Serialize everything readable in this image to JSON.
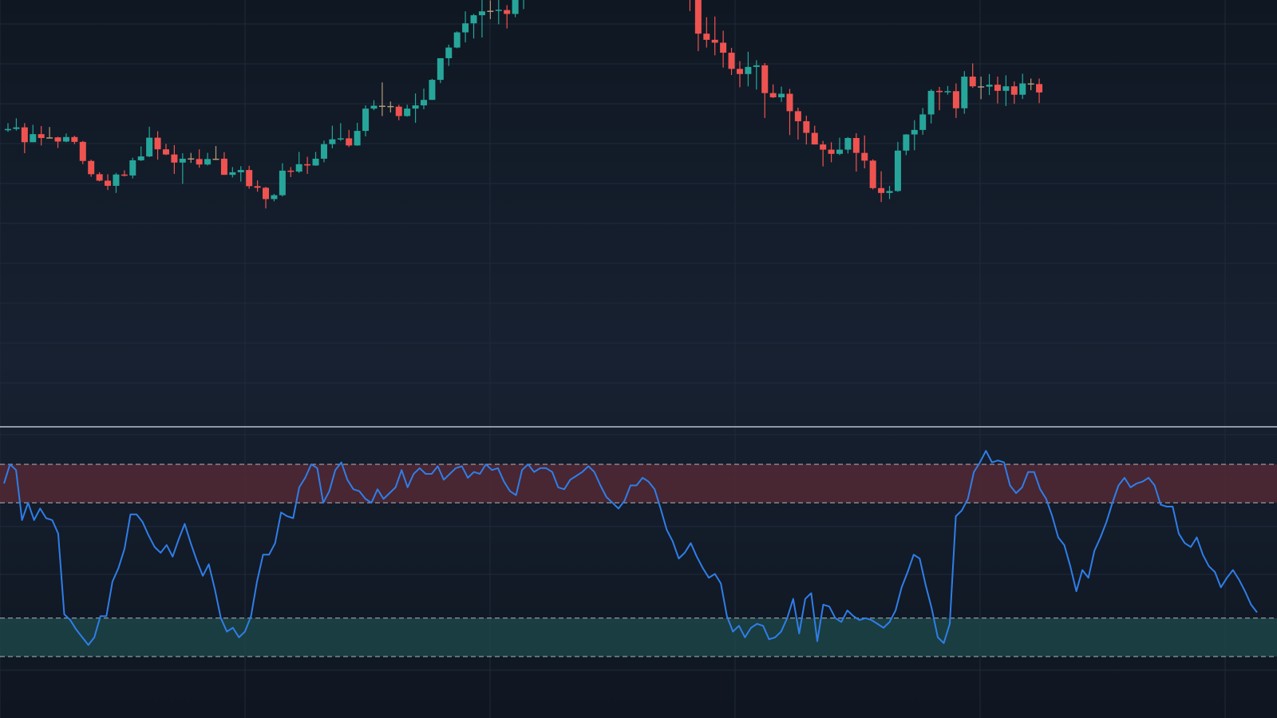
{
  "theme": {
    "bg_top": "#0f1722",
    "bg_mid": "#172131",
    "bg_bottom": "#0f1621",
    "grid": "#1f2a39",
    "separator": "#b9c2cc",
    "up": "#26a69a",
    "down": "#ef5350",
    "doji": "#b39a7a",
    "line": "#2f7ee8",
    "overbought_fill": "#5a2a35",
    "oversold_fill": "#1d4a4b",
    "band_line": "#c9ced6"
  },
  "chart_data": [
    {
      "type": "candlestick",
      "title": "",
      "xlabel": "",
      "ylabel": "",
      "grid": true,
      "ylim": [
        0,
        100
      ],
      "candles": [
        [
          74.5,
          74.9,
          76.7,
          74.0
        ],
        [
          74.9,
          75.4,
          78.2,
          74.4
        ],
        [
          75.4,
          70.8,
          76.7,
          67.4
        ],
        [
          70.8,
          73.3,
          76.2,
          70.8
        ],
        [
          73.3,
          72.1,
          75.8,
          69.8
        ],
        [
          72.1,
          72.3,
          75.5,
          72.1
        ],
        [
          72.3,
          71.0,
          72.5,
          69.0
        ],
        [
          71.0,
          72.4,
          73.5,
          70.8
        ],
        [
          72.4,
          70.9,
          72.8,
          70.2
        ],
        [
          70.9,
          65.0,
          71.2,
          64.0
        ],
        [
          65.0,
          60.9,
          65.4,
          60.1
        ],
        [
          60.9,
          58.9,
          61.5,
          58.7
        ],
        [
          58.9,
          57.3,
          60.9,
          56.0
        ],
        [
          57.3,
          60.8,
          61.3,
          55.1
        ],
        [
          60.8,
          60.5,
          62.1,
          60.2
        ],
        [
          60.5,
          65.2,
          66.0,
          59.6
        ],
        [
          65.2,
          66.4,
          69.5,
          65.0
        ],
        [
          66.4,
          72.2,
          75.6,
          66.2
        ],
        [
          72.2,
          68.6,
          74.2,
          65.4
        ],
        [
          68.6,
          67.0,
          70.3,
          66.8
        ],
        [
          67.0,
          64.5,
          69.9,
          61.0
        ],
        [
          64.5,
          65.7,
          67.4,
          57.9
        ],
        [
          65.8,
          65.6,
          67.5,
          64.4
        ],
        [
          65.6,
          63.9,
          68.6,
          62.9
        ],
        [
          63.9,
          65.6,
          67.5,
          63.6
        ],
        [
          65.6,
          65.7,
          69.6,
          65.3
        ],
        [
          65.7,
          60.7,
          67.7,
          60.7
        ],
        [
          60.7,
          61.5,
          63.1,
          59.9
        ],
        [
          61.5,
          62.2,
          63.4,
          58.6
        ],
        [
          62.2,
          57.2,
          63.5,
          56.4
        ],
        [
          57.2,
          56.7,
          59.0,
          55.5
        ],
        [
          56.7,
          53.2,
          57.0,
          50.3
        ],
        [
          53.2,
          54.4,
          54.8,
          52.5
        ],
        [
          54.4,
          62.0,
          64.3,
          54.0
        ],
        [
          62.0,
          61.7,
          63.1,
          60.0
        ],
        [
          61.7,
          64.0,
          67.8,
          61.3
        ],
        [
          64.0,
          63.6,
          66.3,
          61.0
        ],
        [
          63.6,
          65.7,
          67.8,
          63.5
        ],
        [
          65.7,
          70.2,
          71.3,
          64.6
        ],
        [
          70.2,
          71.7,
          75.9,
          68.9
        ],
        [
          71.7,
          72.0,
          76.7,
          71.2
        ],
        [
          72.0,
          69.8,
          74.6,
          69.3
        ],
        [
          69.8,
          74.3,
          76.8,
          69.7
        ],
        [
          74.3,
          81.2,
          82.2,
          72.6
        ],
        [
          81.2,
          82.1,
          83.8,
          80.7
        ],
        [
          82.1,
          82.0,
          89.3,
          78.9
        ],
        [
          82.0,
          81.8,
          83.4,
          80.0
        ],
        [
          81.8,
          78.9,
          82.4,
          77.6
        ],
        [
          78.9,
          81.2,
          82.4,
          78.7
        ],
        [
          81.2,
          82.2,
          85.9,
          76.8
        ],
        [
          82.2,
          83.9,
          87.4,
          81.0
        ],
        [
          83.9,
          90.1,
          90.4,
          83.9
        ],
        [
          90.1,
          96.8,
          96.8,
          89.1
        ],
        [
          96.8,
          100.1,
          101.0,
          94.4
        ],
        [
          100.1,
          104.8,
          105.1,
          99.9
        ],
        [
          104.8,
          107.6,
          111.3,
          101.7
        ],
        [
          107.6,
          110.1,
          110.5,
          102.9
        ],
        [
          110.1,
          111.3,
          115.3,
          103.2
        ],
        [
          111.3,
          111.5,
          114.7,
          108.9
        ],
        [
          111.5,
          111.8,
          114.9,
          107.3
        ],
        [
          111.7,
          110.5,
          113.2,
          106.0
        ],
        [
          110.5,
          116.2,
          117.0,
          109.5
        ],
        [
          116.2,
          120.9,
          123.2,
          112.0
        ],
        [
          120.9,
          127.4,
          130.8,
          120.2
        ],
        [
          127.4,
          131.1,
          134.5,
          125.8
        ],
        [
          131.1,
          127.7,
          133.8,
          123.3
        ],
        [
          127.7,
          126.3,
          131.6,
          124.2
        ],
        [
          126.3,
          121.2,
          128.4,
          117.1
        ],
        [
          121.2,
          120.4,
          124.5,
          115.2
        ],
        [
          120.4,
          121.2,
          123.8,
          119.7
        ],
        [
          121.2,
          127.8,
          130.5,
          120.4
        ],
        [
          127.8,
          127.9,
          129.2,
          127.3
        ],
        [
          127.9,
          127.9,
          129.2,
          127.1
        ],
        [
          127.9,
          130.7,
          132.0,
          127.3
        ],
        [
          130.7,
          126.4,
          132.8,
          125.9
        ],
        [
          126.4,
          127.7,
          131.8,
          126.4
        ],
        [
          127.7,
          131.0,
          133.5,
          127.1
        ],
        [
          131.0,
          126.3,
          132.0,
          123.3
        ],
        [
          126.3,
          122.0,
          127.1,
          115.9
        ],
        [
          122.0,
          121.2,
          124.2,
          117.5
        ],
        [
          121.2,
          125.0,
          127.7,
          118.7
        ],
        [
          125.0,
          121.4,
          126.9,
          117.6
        ],
        [
          121.4,
          114.9,
          124.9,
          111.4
        ],
        [
          114.9,
          104.4,
          117.0,
          99.0
        ],
        [
          104.4,
          102.5,
          109.5,
          100.1
        ],
        [
          102.5,
          101.6,
          109.7,
          97.7
        ],
        [
          101.6,
          98.5,
          105.3,
          93.9
        ],
        [
          98.5,
          93.5,
          100.0,
          91.6
        ],
        [
          93.5,
          91.9,
          95.9,
          87.8
        ],
        [
          91.9,
          94.1,
          98.8,
          88.1
        ],
        [
          94.1,
          94.6,
          96.2,
          87.1
        ],
        [
          94.6,
          86.0,
          95.3,
          78.3
        ],
        [
          86.0,
          84.7,
          88.7,
          84.5
        ],
        [
          84.7,
          85.8,
          88.0,
          83.3
        ],
        [
          85.8,
          80.4,
          87.3,
          73.0
        ],
        [
          80.4,
          77.3,
          81.5,
          71.6
        ],
        [
          77.3,
          73.7,
          79.0,
          70.1
        ],
        [
          73.7,
          70.1,
          75.9,
          70.1
        ],
        [
          70.1,
          68.5,
          71.2,
          63.3
        ],
        [
          68.5,
          67.2,
          70.8,
          64.6
        ],
        [
          67.2,
          68.5,
          72.2,
          66.8
        ],
        [
          68.5,
          72.1,
          72.4,
          67.3
        ],
        [
          72.1,
          67.5,
          73.6,
          61.7
        ],
        [
          67.5,
          65.1,
          72.9,
          62.7
        ],
        [
          65.1,
          56.6,
          65.5,
          56.2
        ],
        [
          56.6,
          55.1,
          61.8,
          52.3
        ],
        [
          55.1,
          55.7,
          57.3,
          53.2
        ],
        [
          55.7,
          68.2,
          70.9,
          55.4
        ],
        [
          68.2,
          73.2,
          73.3,
          66.8
        ],
        [
          73.2,
          74.6,
          77.6,
          68.3
        ],
        [
          74.6,
          79.4,
          81.4,
          73.1
        ],
        [
          79.4,
          86.7,
          87.2,
          76.6
        ],
        [
          86.7,
          86.3,
          87.9,
          80.7
        ],
        [
          86.3,
          86.6,
          88.2,
          85.5
        ],
        [
          86.6,
          81.3,
          89.0,
          78.3
        ],
        [
          81.3,
          91.1,
          92.8,
          79.6
        ],
        [
          91.1,
          88.1,
          95.2,
          87.6
        ],
        [
          88.1,
          88.0,
          91.1,
          84.1
        ],
        [
          88.0,
          88.6,
          91.9,
          85.4
        ],
        [
          88.6,
          86.7,
          91.1,
          82.8
        ],
        [
          86.7,
          88.1,
          91.5,
          82.0
        ],
        [
          88.1,
          85.5,
          89.6,
          82.7
        ],
        [
          85.5,
          89.0,
          92.0,
          84.2
        ],
        [
          89.0,
          88.8,
          90.5,
          86.9
        ],
        [
          88.8,
          86.2,
          90.5,
          82.9
        ]
      ]
    },
    {
      "type": "line",
      "title": "",
      "xlabel": "",
      "ylabel": "",
      "grid": true,
      "ylim": [
        0,
        100
      ],
      "bands": {
        "overbought": [
          80,
          100
        ],
        "oversold": [
          0,
          20
        ]
      },
      "series": [
        {
          "values": [
            90,
            100,
            97,
            71,
            80,
            71,
            77,
            72,
            71,
            64,
            22,
            19,
            14,
            10,
            6,
            10,
            21,
            21,
            39,
            46,
            56,
            74,
            74,
            70,
            63,
            57,
            54,
            58,
            52,
            61,
            69,
            59,
            50,
            42,
            48,
            35,
            20,
            13,
            15,
            10,
            13,
            21,
            39,
            53,
            53,
            59,
            75,
            73,
            72,
            88,
            93,
            100,
            98,
            80,
            86,
            97,
            101,
            92,
            87,
            86,
            82,
            80,
            87,
            82,
            85,
            88,
            97,
            88,
            95,
            98,
            95,
            95,
            99,
            92,
            95,
            98,
            99,
            93,
            96,
            95,
            100,
            97,
            98,
            91,
            86,
            84,
            97,
            100,
            96,
            98,
            98,
            96,
            88,
            87,
            92,
            94,
            96,
            99,
            96,
            89,
            83,
            80,
            77,
            81,
            89,
            89,
            93,
            91,
            87,
            77,
            66,
            60,
            51,
            54,
            59,
            52,
            46,
            41,
            43,
            38,
            21,
            13,
            16,
            10,
            15,
            17,
            16,
            9,
            10,
            13,
            20,
            30,
            12,
            30,
            33,
            8,
            27,
            26,
            20,
            18,
            24,
            21,
            19,
            20,
            19,
            17,
            15,
            18,
            24,
            36,
            44,
            53,
            51,
            37,
            25,
            10,
            7,
            17,
            73,
            76,
            82,
            96,
            101,
            107,
            101,
            102,
            101,
            89,
            85,
            88,
            96,
            96,
            87,
            82,
            73,
            62,
            58,
            47,
            34,
            45,
            41,
            55,
            62,
            70,
            80,
            89,
            93,
            88,
            90,
            91,
            93,
            89,
            79,
            78,
            78,
            64,
            59,
            57,
            62,
            53,
            47,
            44,
            36,
            41,
            45,
            40,
            34,
            27,
            23
          ]
        }
      ]
    }
  ]
}
